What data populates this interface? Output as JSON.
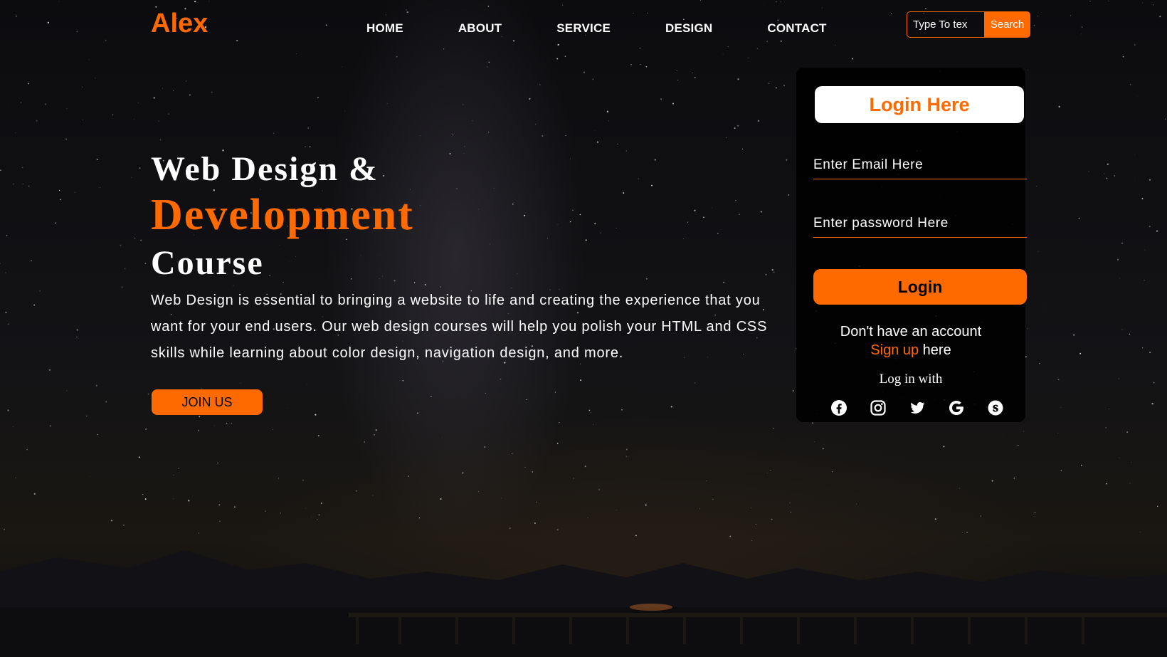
{
  "header": {
    "logo": "Alex",
    "nav": [
      "HOME",
      "ABOUT",
      "SERVICE",
      "DESIGN",
      "CONTACT"
    ],
    "search": {
      "placeholder": "Type To tex",
      "button": "Search"
    }
  },
  "hero": {
    "line1": "Web Design &",
    "line2": "Development",
    "line3": "Course",
    "description": "Web Design is essential to bringing a website to life and creating the experience that you want for your end users. Our web design courses will help you polish your HTML and CSS skills while learning about color design, navigation design, and more.",
    "cta": "JOIN US"
  },
  "login": {
    "title": "Login Here",
    "email_placeholder": "Enter Email Here",
    "password_placeholder": "Enter password Here",
    "button": "Login",
    "no_account": "Don't have an account",
    "signup_link": "Sign up",
    "signup_suffix": " here",
    "login_with": "Log in with",
    "socials": [
      "facebook-icon",
      "instagram-icon",
      "twitter-icon",
      "google-icon",
      "skype-icon"
    ]
  },
  "colors": {
    "accent": "#ff6a00",
    "text": "#ffffff",
    "panel": "#000000"
  }
}
